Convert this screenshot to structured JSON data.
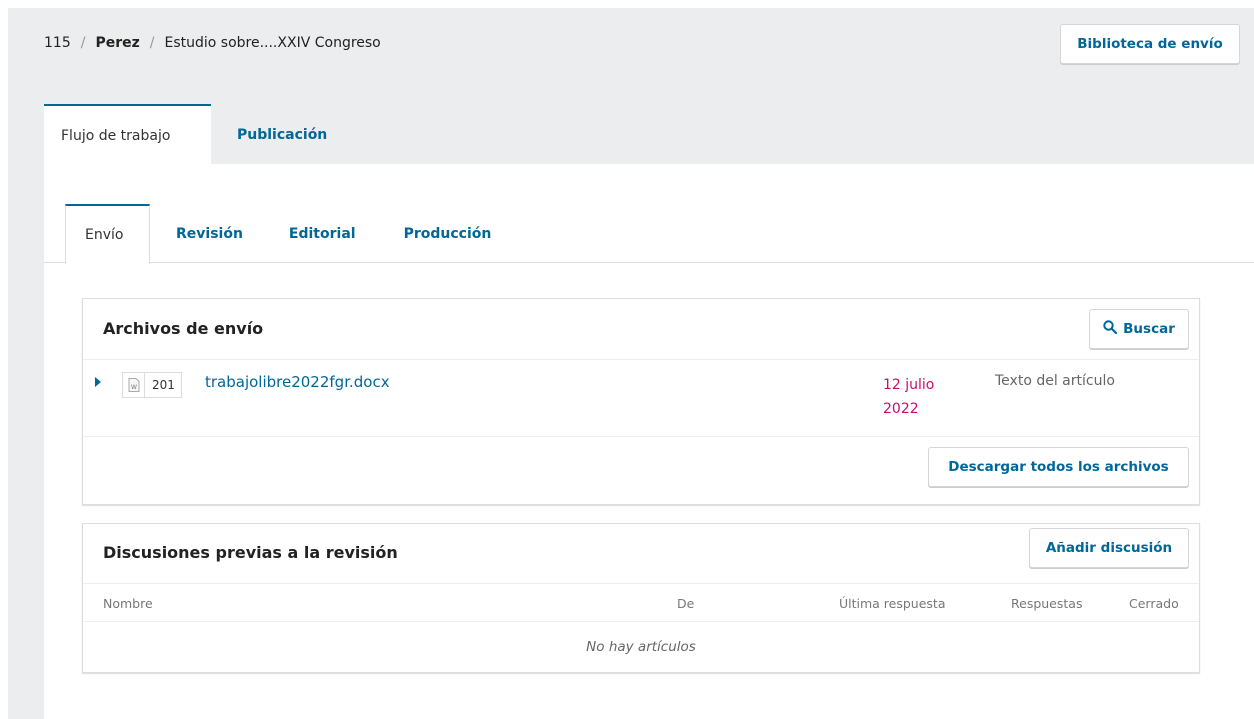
{
  "breadcrumb": {
    "id": "115",
    "author": "Perez",
    "title": "Estudio sobre....XXIV Congreso",
    "separator": "/"
  },
  "header": {
    "library_button": "Biblioteca de envío"
  },
  "main_tabs": [
    {
      "label": "Flujo de trabajo",
      "active": true
    },
    {
      "label": "Publicación",
      "active": false
    }
  ],
  "sub_tabs": [
    {
      "label": "Envío",
      "active": true
    },
    {
      "label": "Revisión",
      "active": false
    },
    {
      "label": "Editorial",
      "active": false
    },
    {
      "label": "Producción",
      "active": false
    }
  ],
  "submission_files": {
    "title": "Archivos de envío",
    "search_button": "Buscar",
    "search_icon": "magnifier-icon",
    "files": [
      {
        "number": "201",
        "name": "trabajolibre2022fgr.docx",
        "date": "12 julio 2022",
        "type": "Texto del artículo",
        "icon": "word-document-icon"
      }
    ],
    "download_all_button": "Descargar todos los archivos"
  },
  "discussions": {
    "title": "Discusiones previas a la revisión",
    "add_button": "Añadir discusión",
    "columns": [
      "Nombre",
      "De",
      "Última respuesta",
      "Respuestas",
      "Cerrado"
    ],
    "empty_text": "No hay artículos"
  },
  "colors": {
    "accent": "#006798",
    "date": "#d00a6c",
    "background": "#ecedee"
  }
}
